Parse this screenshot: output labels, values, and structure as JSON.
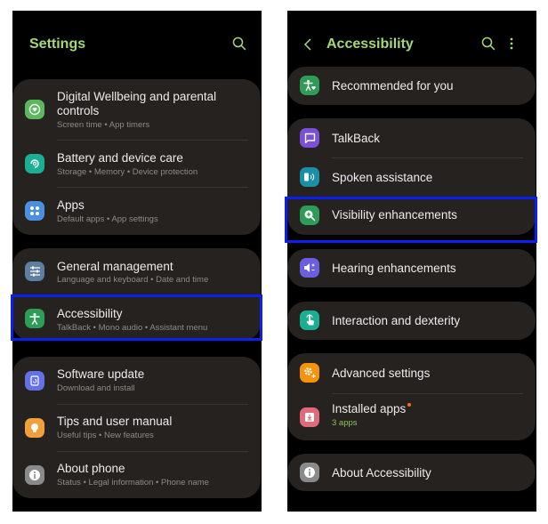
{
  "settings_screen": {
    "title": "Settings",
    "search_icon": "search-icon",
    "groups": [
      {
        "items": [
          {
            "label": "Digital Wellbeing and parental controls",
            "label_line1": "Digital Wellbeing and parental",
            "label_line2": "controls",
            "subtitle": "Screen time  •  App timers",
            "icon": "digital-wellbeing-icon",
            "color": "#5cb85c"
          },
          {
            "label": "Battery and device care",
            "subtitle": "Storage  •  Memory  •  Device protection",
            "icon": "device-care-icon",
            "color": "#1aaf93"
          },
          {
            "label": "Apps",
            "subtitle": "Default apps  •  App settings",
            "icon": "apps-icon",
            "color": "#4a8fe0"
          }
        ]
      },
      {
        "items": [
          {
            "label": "General management",
            "subtitle": "Language and keyboard  •  Date and time",
            "icon": "general-management-icon",
            "color": "#5e7fa0"
          },
          {
            "label": "Accessibility",
            "subtitle": "TalkBack  •  Mono audio  •  Assistant menu",
            "icon": "accessibility-icon",
            "color": "#2e9b57",
            "highlighted": true
          }
        ]
      },
      {
        "items": [
          {
            "label": "Software update",
            "subtitle": "Download and install",
            "icon": "software-update-icon",
            "color": "#6470e6"
          },
          {
            "label": "Tips and user manual",
            "subtitle": "Useful tips  •  New features",
            "icon": "tips-icon",
            "color": "#f0a03a"
          },
          {
            "label": "About phone",
            "subtitle": "Status  •  Legal information  •  Phone name",
            "icon": "about-phone-icon",
            "color": "#8a8a8a"
          }
        ]
      }
    ]
  },
  "accessibility_screen": {
    "title": "Accessibility",
    "back_icon": "back-arrow-icon",
    "search_icon": "search-icon",
    "more_icon": "more-options-icon",
    "groups": [
      {
        "items": [
          {
            "label": "Recommended for you",
            "icon": "recommended-icon",
            "color": "#2e9b57"
          }
        ]
      },
      {
        "items": [
          {
            "label": "TalkBack",
            "icon": "talkback-icon",
            "color": "#7b4fd6"
          },
          {
            "label": "Spoken assistance",
            "icon": "spoken-assistance-icon",
            "color": "#1a8fa8"
          },
          {
            "label": "Visibility enhancements",
            "icon": "visibility-icon",
            "color": "#2e9b57",
            "highlighted": true
          }
        ]
      },
      {
        "items": [
          {
            "label": "Hearing enhancements",
            "icon": "hearing-icon",
            "color": "#6a5fe0"
          }
        ]
      },
      {
        "items": [
          {
            "label": "Interaction and dexterity",
            "icon": "interaction-icon",
            "color": "#1aaf93"
          }
        ]
      },
      {
        "items": [
          {
            "label": "Advanced settings",
            "icon": "advanced-settings-icon",
            "color": "#f5930c"
          },
          {
            "label": "Installed apps",
            "subtitle": "3 apps",
            "icon": "installed-apps-icon",
            "color": "#e06a7a",
            "badge_color": "#ff6a1a"
          }
        ]
      },
      {
        "items": [
          {
            "label": "About Accessibility",
            "icon": "about-accessibility-icon",
            "color": "#8a8a8a"
          }
        ]
      }
    ]
  },
  "colors": {
    "accent": "#a3d977",
    "highlight": "#0a1ff0",
    "card": "#252220",
    "background": "#000000",
    "subtitle_green": "#8fc25a"
  }
}
